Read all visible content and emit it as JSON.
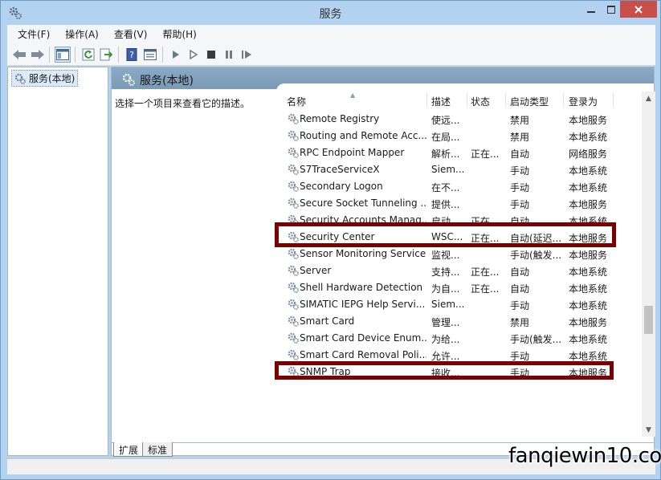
{
  "window": {
    "title": "服务"
  },
  "menu": [
    "文件(F)",
    "操作(A)",
    "查看(V)",
    "帮助(H)"
  ],
  "tree": {
    "selected_label": "服务(本地)"
  },
  "panel": {
    "title": "服务(本地)",
    "description": "选择一个项目来查看它的描述。"
  },
  "columns": {
    "name": "名称",
    "desc": "描述",
    "status": "状态",
    "startup": "启动类型",
    "logon": "登录为"
  },
  "rows": [
    {
      "name": "Remote Registry",
      "desc": "使远...",
      "status": "",
      "startup": "禁用",
      "logon": "本地服务"
    },
    {
      "name": "Routing and Remote Acc...",
      "desc": "在局...",
      "status": "",
      "startup": "禁用",
      "logon": "本地系统"
    },
    {
      "name": "RPC Endpoint Mapper",
      "desc": "解析...",
      "status": "正在...",
      "startup": "自动",
      "logon": "网络服务"
    },
    {
      "name": "S7TraceServiceX",
      "desc": "Siem...",
      "status": "",
      "startup": "手动",
      "logon": "本地系统"
    },
    {
      "name": "Secondary Logon",
      "desc": "在不...",
      "status": "",
      "startup": "手动",
      "logon": "本地系统"
    },
    {
      "name": "Secure Socket Tunneling ...",
      "desc": "提供...",
      "status": "",
      "startup": "手动",
      "logon": "本地服务"
    },
    {
      "name": "Security Accounts Manag...",
      "desc": "启动...",
      "status": "正在...",
      "startup": "自动",
      "logon": "本地系统"
    },
    {
      "name": "Security Center",
      "desc": "WSC...",
      "status": "正在...",
      "startup": "自动(延迟...",
      "logon": "本地服务"
    },
    {
      "name": "Sensor Monitoring Service",
      "desc": "监视...",
      "status": "",
      "startup": "手动(触发...",
      "logon": "本地服务"
    },
    {
      "name": "Server",
      "desc": "支持...",
      "status": "正在...",
      "startup": "自动",
      "logon": "本地系统"
    },
    {
      "name": "Shell Hardware Detection",
      "desc": "为自...",
      "status": "正在...",
      "startup": "自动",
      "logon": "本地系统"
    },
    {
      "name": "SIMATIC IEPG Help Servi...",
      "desc": "Siem...",
      "status": "",
      "startup": "手动",
      "logon": "本地系统"
    },
    {
      "name": "Smart Card",
      "desc": "管理...",
      "status": "",
      "startup": "禁用",
      "logon": "本地服务"
    },
    {
      "name": "Smart Card Device Enum...",
      "desc": "为给...",
      "status": "",
      "startup": "手动(触发...",
      "logon": "本地系统"
    },
    {
      "name": "Smart Card Removal Poli...",
      "desc": "允许...",
      "status": "",
      "startup": "手动",
      "logon": "本地系统"
    },
    {
      "name": "SNMP Trap",
      "desc": "接收...",
      "status": "",
      "startup": "手动",
      "logon": "本地服务"
    }
  ],
  "tabs": {
    "extended": "扩展",
    "standard": "标准"
  },
  "watermark": "fanqiewin10.com",
  "colors": {
    "highlight": "#7b0000",
    "close": "#c7504b",
    "frame": "#b3d2ef"
  }
}
